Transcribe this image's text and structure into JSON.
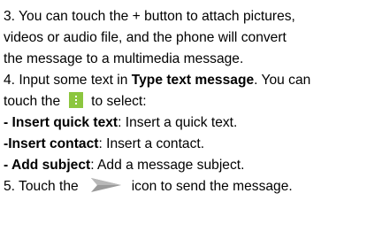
{
  "steps": {
    "step3_line1": "3. You can touch the + button to attach pictures,",
    "step3_line2": "videos or audio file, and the phone will convert",
    "step3_line3": "the message to a multimedia message.",
    "step4_prefix": "4. Input some text in ",
    "step4_bold": "Type text message",
    "step4_suffix": ". You can",
    "step4_line2_prefix": "touch the",
    "step4_line2_suffix": "to select:",
    "opt1_bold": "- Insert quick text",
    "opt1_text": ": Insert a quick text.",
    "opt2_bold": "-Insert contact",
    "opt2_text": ": Insert a contact.",
    "opt3_bold": "- Add subject",
    "opt3_text": ": Add a message subject.",
    "step5_prefix": "5. Touch the",
    "step5_suffix": "icon to send the message."
  },
  "icons": {
    "menu_icon": "menu-dots-icon",
    "menu_icon_color": "#8cc63f",
    "send_icon": "send-arrow-icon",
    "send_icon_color": "#9a9a9a"
  }
}
